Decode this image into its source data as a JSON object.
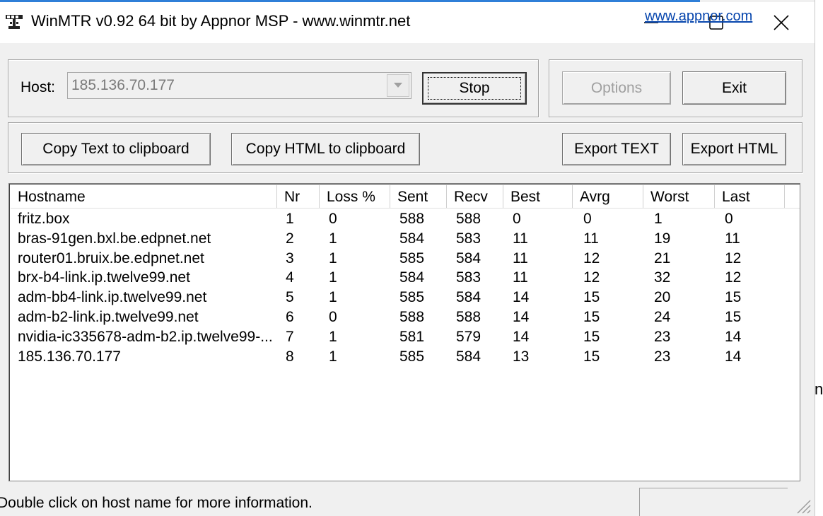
{
  "window": {
    "title": "WinMTR v0.92 64 bit by Appnor MSP - www.winmtr.net",
    "minimize_icon": "minimize-icon",
    "maximize_icon": "maximize-icon",
    "close_icon": "close-icon"
  },
  "host": {
    "label": "Host:",
    "value": "185.136.70.177"
  },
  "buttons": {
    "stop": "Stop",
    "options": "Options",
    "exit": "Exit",
    "copy_text": "Copy Text to clipboard",
    "copy_html": "Copy HTML to clipboard",
    "export_text": "Export TEXT",
    "export_html": "Export HTML"
  },
  "table": {
    "columns": [
      "Hostname",
      "Nr",
      "Loss %",
      "Sent",
      "Recv",
      "Best",
      "Avrg",
      "Worst",
      "Last"
    ],
    "rows": [
      [
        "fritz.box",
        "1",
        "0",
        "588",
        "588",
        "0",
        "0",
        "1",
        "0"
      ],
      [
        "bras-91gen.bxl.be.edpnet.net",
        "2",
        "1",
        "584",
        "583",
        "11",
        "11",
        "19",
        "11"
      ],
      [
        "router01.bruix.be.edpnet.net",
        "3",
        "1",
        "585",
        "584",
        "11",
        "12",
        "21",
        "12"
      ],
      [
        "brx-b4-link.ip.twelve99.net",
        "4",
        "1",
        "584",
        "583",
        "11",
        "12",
        "32",
        "12"
      ],
      [
        "adm-bb4-link.ip.twelve99.net",
        "5",
        "1",
        "585",
        "584",
        "14",
        "15",
        "20",
        "15"
      ],
      [
        "adm-b2-link.ip.twelve99.net",
        "6",
        "0",
        "588",
        "588",
        "14",
        "15",
        "24",
        "15"
      ],
      [
        "nvidia-ic335678-adm-b2.ip.twelve99-...",
        "7",
        "1",
        "581",
        "579",
        "14",
        "15",
        "23",
        "14"
      ],
      [
        "185.136.70.177",
        "8",
        "1",
        "585",
        "584",
        "13",
        "15",
        "23",
        "14"
      ]
    ]
  },
  "status": {
    "message": "Double click on host name for more information.",
    "link": "www.appnor.com"
  },
  "background": {
    "edge_char": "n"
  }
}
